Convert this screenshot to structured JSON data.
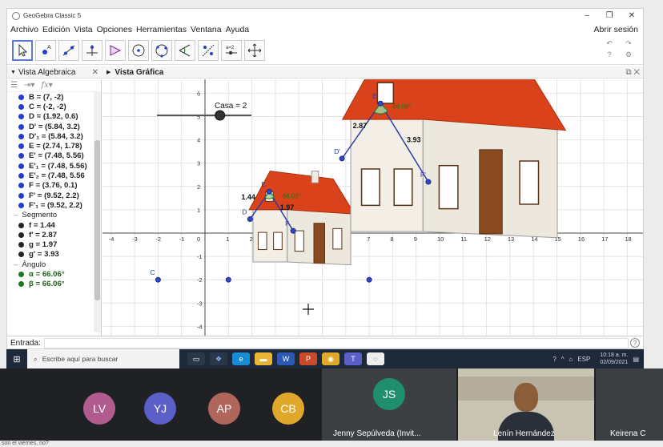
{
  "window": {
    "title": "GeoGebra Classic 5",
    "controls": [
      "–",
      "❐",
      "✕"
    ]
  },
  "menubar": {
    "items": [
      "Archivo",
      "Edición",
      "Vista",
      "Opciones",
      "Herramientas",
      "Ventana",
      "Ayuda"
    ],
    "login": "Abrir sesión"
  },
  "toolbar": {
    "tools": [
      "move-tool-icon",
      "point-tool-icon",
      "line-tool-icon",
      "perpendicular-tool-icon",
      "polygon-tool-icon",
      "circle-tool-icon",
      "circle-three-points-icon",
      "angle-tool-icon",
      "reflect-tool-icon",
      "slider-tool-icon",
      "move-graphics-view-icon"
    ],
    "slider_tool_label": "a=2",
    "undo": "↶",
    "redo": "↷",
    "help": "?",
    "settings": "⚙"
  },
  "algebra_view": {
    "header": "Vista Algebraica",
    "items": [
      {
        "kind": "point",
        "text": "B = (7, -2)"
      },
      {
        "kind": "point",
        "text": "C = (-2, -2)"
      },
      {
        "kind": "point",
        "text": "D = (1.92, 0.6)"
      },
      {
        "kind": "point",
        "text": "D' = (5.84, 3.2)"
      },
      {
        "kind": "point",
        "text": "D'₁ = (5.84, 3.2)"
      },
      {
        "kind": "point",
        "text": "E = (2.74, 1.78)"
      },
      {
        "kind": "point",
        "text": "E' = (7.48, 5.56)"
      },
      {
        "kind": "point",
        "text": "E'₁ = (7.48, 5.56)"
      },
      {
        "kind": "point",
        "text": "E'₂ = (7.48, 5.56"
      },
      {
        "kind": "point",
        "text": "F = (3.76, 0.1)"
      },
      {
        "kind": "point",
        "text": "F' = (9.52, 2.2)"
      },
      {
        "kind": "point",
        "text": "F'₁ = (9.52, 2.2)"
      },
      {
        "kind": "group",
        "text": "Segmento"
      },
      {
        "kind": "segment",
        "text": "f = 1.44"
      },
      {
        "kind": "segment",
        "text": "f' = 2.87"
      },
      {
        "kind": "segment",
        "text": "g = 1.97"
      },
      {
        "kind": "segment",
        "text": "g' = 3.93"
      },
      {
        "kind": "group",
        "text": "Ángulo"
      },
      {
        "kind": "angle",
        "text": "α = 66.06°"
      },
      {
        "kind": "angle",
        "text": "β = 66.06°"
      }
    ]
  },
  "graphics_view": {
    "header": "Vista Gráfica",
    "x_ticks": [
      "-4",
      "-3",
      "-2",
      "-1",
      "0",
      "1",
      "2",
      "3",
      "4",
      "5",
      "6",
      "7",
      "8",
      "9",
      "10",
      "11",
      "12",
      "13",
      "14",
      "15",
      "16",
      "17",
      "18"
    ],
    "y_ticks": [
      "-4",
      "-3",
      "-2",
      "-1",
      "1",
      "2",
      "3",
      "4",
      "5",
      "6"
    ],
    "slider": {
      "label": "Casa = 2",
      "value": 2,
      "min": 0,
      "max": 3
    },
    "points": [
      {
        "label": "C",
        "x": -2,
        "y": -2
      },
      {
        "label": "",
        "x": 1,
        "y": -2
      },
      {
        "label": "",
        "x": 7,
        "y": -2
      },
      {
        "label": "D",
        "x": 1.92,
        "y": 0.6
      },
      {
        "label": "E",
        "x": 2.74,
        "y": 1.78
      },
      {
        "label": "F",
        "x": 3.76,
        "y": 0.1
      },
      {
        "label": "D'",
        "x": 5.84,
        "y": 3.2
      },
      {
        "label": "E'",
        "x": 7.48,
        "y": 5.56
      },
      {
        "label": "F'",
        "x": 9.52,
        "y": 2.2
      }
    ],
    "segment_labels": [
      {
        "text": "1.44",
        "x": 1.55,
        "y": 1.45
      },
      {
        "text": "1.97",
        "x": 3.2,
        "y": 1.0
      },
      {
        "text": "2.87",
        "x": 6.3,
        "y": 4.5
      },
      {
        "text": "3.93",
        "x": 8.6,
        "y": 3.9
      }
    ],
    "angle_labels": [
      {
        "text": "66.06°",
        "x": 3.3,
        "y": 1.5
      },
      {
        "text": "66.06°",
        "x": 8.0,
        "y": 5.35
      }
    ]
  },
  "input_bar": {
    "label": "Entrada:"
  },
  "taskbar": {
    "search_placeholder": "Escribe aquí para buscar",
    "lang": "ESP",
    "time": "10:18 a. m.",
    "date": "02/09/2021"
  },
  "meet": {
    "participants": [
      {
        "initials": "LV",
        "color": "#b15b8f"
      },
      {
        "initials": "YJ",
        "color": "#5b5fc7"
      },
      {
        "initials": "AP",
        "color": "#b0665b"
      },
      {
        "initials": "CB",
        "color": "#e0a82a"
      }
    ],
    "tiles": [
      {
        "initials": "JS",
        "name": "Jenny Sepúlveda (Invit...",
        "color": "#1e8e6e"
      },
      {
        "name": "Lenín Hernández"
      },
      {
        "name": "Keirena C"
      }
    ],
    "chat_preview": "son el viernes, no?"
  }
}
